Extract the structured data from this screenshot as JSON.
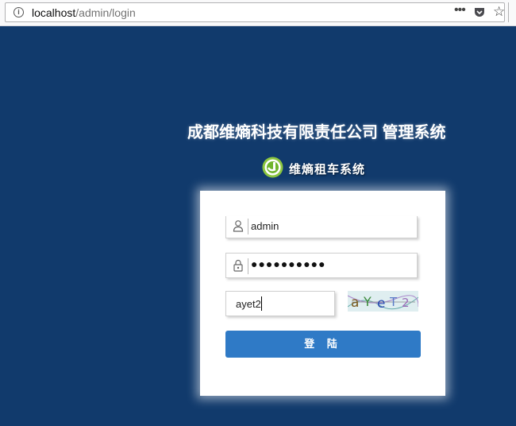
{
  "browser": {
    "url_host": "localhost",
    "url_path": "/admin/login",
    "info_icon": "i",
    "more_icon": "•••",
    "star_icon": "☆"
  },
  "page": {
    "system_title": "成都维熵科技有限责任公司 管理系统",
    "logo_text": "维熵租车系统",
    "background_color": "#113a6c"
  },
  "login": {
    "username_value": "admin",
    "password_value": "●●●●●●●●●●",
    "captcha_value": "ayet2",
    "captcha_image_text": "aYeT2",
    "submit_label": "登 陆",
    "button_color": "#2f7ac6"
  }
}
